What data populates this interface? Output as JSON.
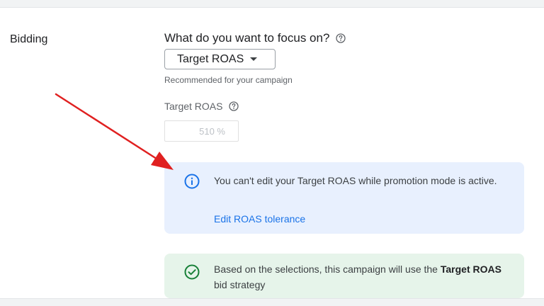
{
  "section": {
    "label": "Bidding"
  },
  "focus": {
    "question": "What do you want to focus on?",
    "selected": "Target ROAS",
    "hint": "Recommended for your campaign"
  },
  "target_roas": {
    "label": "Target ROAS",
    "value": "510 %"
  },
  "info": {
    "message": "You can't edit your Target ROAS while promotion mode is active.",
    "link": "Edit ROAS tolerance"
  },
  "success": {
    "prefix": "Based on the selections, this campaign will use the ",
    "strategy": "Target ROAS",
    "suffix": " bid strategy"
  },
  "colors": {
    "accent": "#1a73e8",
    "info_bg": "#e8f0fe",
    "success_bg": "#e6f4ea",
    "success_icon": "#188038",
    "annotation_arrow": "#e02020"
  },
  "icons": [
    "help-icon",
    "chevron-down-icon",
    "info-icon",
    "check-circle-icon",
    "annotation-arrow"
  ]
}
